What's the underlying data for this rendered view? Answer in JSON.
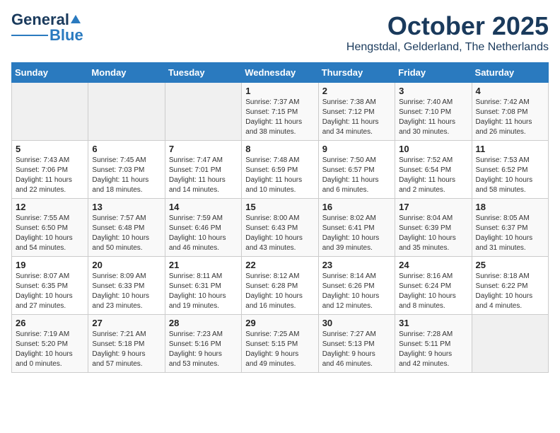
{
  "header": {
    "logo_line1": "General",
    "logo_line2": "Blue",
    "month": "October 2025",
    "location": "Hengstdal, Gelderland, The Netherlands"
  },
  "weekdays": [
    "Sunday",
    "Monday",
    "Tuesday",
    "Wednesday",
    "Thursday",
    "Friday",
    "Saturday"
  ],
  "weeks": [
    [
      {
        "day": "",
        "info": ""
      },
      {
        "day": "",
        "info": ""
      },
      {
        "day": "",
        "info": ""
      },
      {
        "day": "1",
        "info": "Sunrise: 7:37 AM\nSunset: 7:15 PM\nDaylight: 11 hours\nand 38 minutes."
      },
      {
        "day": "2",
        "info": "Sunrise: 7:38 AM\nSunset: 7:12 PM\nDaylight: 11 hours\nand 34 minutes."
      },
      {
        "day": "3",
        "info": "Sunrise: 7:40 AM\nSunset: 7:10 PM\nDaylight: 11 hours\nand 30 minutes."
      },
      {
        "day": "4",
        "info": "Sunrise: 7:42 AM\nSunset: 7:08 PM\nDaylight: 11 hours\nand 26 minutes."
      }
    ],
    [
      {
        "day": "5",
        "info": "Sunrise: 7:43 AM\nSunset: 7:06 PM\nDaylight: 11 hours\nand 22 minutes."
      },
      {
        "day": "6",
        "info": "Sunrise: 7:45 AM\nSunset: 7:03 PM\nDaylight: 11 hours\nand 18 minutes."
      },
      {
        "day": "7",
        "info": "Sunrise: 7:47 AM\nSunset: 7:01 PM\nDaylight: 11 hours\nand 14 minutes."
      },
      {
        "day": "8",
        "info": "Sunrise: 7:48 AM\nSunset: 6:59 PM\nDaylight: 11 hours\nand 10 minutes."
      },
      {
        "day": "9",
        "info": "Sunrise: 7:50 AM\nSunset: 6:57 PM\nDaylight: 11 hours\nand 6 minutes."
      },
      {
        "day": "10",
        "info": "Sunrise: 7:52 AM\nSunset: 6:54 PM\nDaylight: 11 hours\nand 2 minutes."
      },
      {
        "day": "11",
        "info": "Sunrise: 7:53 AM\nSunset: 6:52 PM\nDaylight: 10 hours\nand 58 minutes."
      }
    ],
    [
      {
        "day": "12",
        "info": "Sunrise: 7:55 AM\nSunset: 6:50 PM\nDaylight: 10 hours\nand 54 minutes."
      },
      {
        "day": "13",
        "info": "Sunrise: 7:57 AM\nSunset: 6:48 PM\nDaylight: 10 hours\nand 50 minutes."
      },
      {
        "day": "14",
        "info": "Sunrise: 7:59 AM\nSunset: 6:46 PM\nDaylight: 10 hours\nand 46 minutes."
      },
      {
        "day": "15",
        "info": "Sunrise: 8:00 AM\nSunset: 6:43 PM\nDaylight: 10 hours\nand 43 minutes."
      },
      {
        "day": "16",
        "info": "Sunrise: 8:02 AM\nSunset: 6:41 PM\nDaylight: 10 hours\nand 39 minutes."
      },
      {
        "day": "17",
        "info": "Sunrise: 8:04 AM\nSunset: 6:39 PM\nDaylight: 10 hours\nand 35 minutes."
      },
      {
        "day": "18",
        "info": "Sunrise: 8:05 AM\nSunset: 6:37 PM\nDaylight: 10 hours\nand 31 minutes."
      }
    ],
    [
      {
        "day": "19",
        "info": "Sunrise: 8:07 AM\nSunset: 6:35 PM\nDaylight: 10 hours\nand 27 minutes."
      },
      {
        "day": "20",
        "info": "Sunrise: 8:09 AM\nSunset: 6:33 PM\nDaylight: 10 hours\nand 23 minutes."
      },
      {
        "day": "21",
        "info": "Sunrise: 8:11 AM\nSunset: 6:31 PM\nDaylight: 10 hours\nand 19 minutes."
      },
      {
        "day": "22",
        "info": "Sunrise: 8:12 AM\nSunset: 6:28 PM\nDaylight: 10 hours\nand 16 minutes."
      },
      {
        "day": "23",
        "info": "Sunrise: 8:14 AM\nSunset: 6:26 PM\nDaylight: 10 hours\nand 12 minutes."
      },
      {
        "day": "24",
        "info": "Sunrise: 8:16 AM\nSunset: 6:24 PM\nDaylight: 10 hours\nand 8 minutes."
      },
      {
        "day": "25",
        "info": "Sunrise: 8:18 AM\nSunset: 6:22 PM\nDaylight: 10 hours\nand 4 minutes."
      }
    ],
    [
      {
        "day": "26",
        "info": "Sunrise: 7:19 AM\nSunset: 5:20 PM\nDaylight: 10 hours\nand 0 minutes."
      },
      {
        "day": "27",
        "info": "Sunrise: 7:21 AM\nSunset: 5:18 PM\nDaylight: 9 hours\nand 57 minutes."
      },
      {
        "day": "28",
        "info": "Sunrise: 7:23 AM\nSunset: 5:16 PM\nDaylight: 9 hours\nand 53 minutes."
      },
      {
        "day": "29",
        "info": "Sunrise: 7:25 AM\nSunset: 5:15 PM\nDaylight: 9 hours\nand 49 minutes."
      },
      {
        "day": "30",
        "info": "Sunrise: 7:27 AM\nSunset: 5:13 PM\nDaylight: 9 hours\nand 46 minutes."
      },
      {
        "day": "31",
        "info": "Sunrise: 7:28 AM\nSunset: 5:11 PM\nDaylight: 9 hours\nand 42 minutes."
      },
      {
        "day": "",
        "info": ""
      }
    ]
  ]
}
